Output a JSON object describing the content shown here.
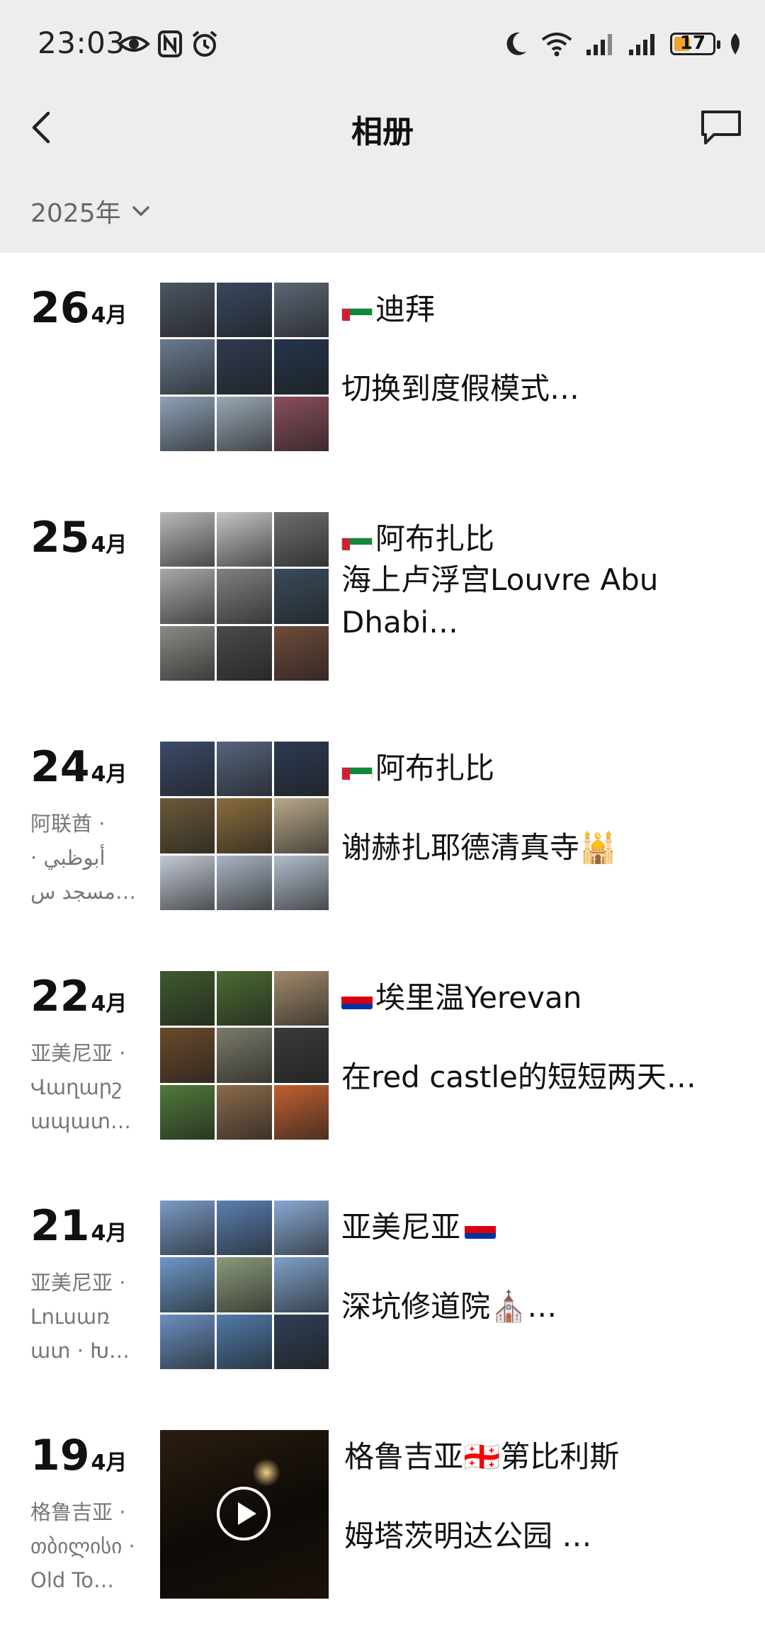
{
  "status_bar": {
    "time": "23:03",
    "battery": "17",
    "icons": [
      "eye-icon",
      "nfc-icon",
      "alarm-icon",
      "moon-icon",
      "wifi-icon",
      "signal-icon",
      "signal-icon",
      "battery-icon",
      "leaf-icon"
    ]
  },
  "header": {
    "title": "相册",
    "back_icon": "chevron-left-icon",
    "message_icon": "message-icon"
  },
  "filter": {
    "year": "2025年"
  },
  "entries": [
    {
      "day": "26",
      "month": "4月",
      "location": "",
      "title": "迪拜",
      "title_flag": "uae",
      "desc": "切换到度假模式…",
      "thumbs": [
        "#4c5562",
        "#39485e",
        "#5b6675",
        "#6a7b8f",
        "#2f3b4f",
        "#24354b",
        "#8fa2b7",
        "#9aa8b5",
        "#8b4e5a"
      ]
    },
    {
      "day": "25",
      "month": "4月",
      "location": "",
      "title": "阿布扎比",
      "title_flag": "uae",
      "desc": "海上卢浮宫Louvre Abu Dhabi…",
      "thumbs": [
        "#b9b9b9",
        "#c4c4c4",
        "#6e6e6e",
        "#a8a8a8",
        "#808080",
        "#3a4b5a",
        "#8c8a84",
        "#4a4a4a",
        "#6f4b3a"
      ]
    },
    {
      "day": "24",
      "month": "4月",
      "location": "阿联酋 · أبوظبي · مسجد س…",
      "title": "阿布扎比",
      "title_flag": "uae",
      "desc": "谢赫扎耶德清真寺🕌",
      "thumbs": [
        "#3c4b6a",
        "#56647c",
        "#2d3a52",
        "#6b5a3a",
        "#8a6d3d",
        "#b7a88a",
        "#c3cad6",
        "#a9b4c2",
        "#b1bdcb"
      ]
    },
    {
      "day": "22",
      "month": "4月",
      "location": "亚美尼亚 · Վաղարշ ապատ…",
      "title": "埃里温Yerevan",
      "title_flag": "armenia",
      "desc": "在red castle的短短两天…",
      "thumbs": [
        "#3f5a2d",
        "#4b6b32",
        "#a08a6a",
        "#6b4a2b",
        "#7b7a6a",
        "#3a3a3a",
        "#507a3a",
        "#8a6a4a",
        "#c06030"
      ]
    },
    {
      "day": "21",
      "month": "4月",
      "location": "亚美尼亚 · Լուսառ ատ · Խ…",
      "title": "亚美尼亚",
      "title_flag": "armenia",
      "desc": "深坑修道院⛪…",
      "thumbs": [
        "#7a9bc6",
        "#5b7fb0",
        "#88a9d3",
        "#6c98c7",
        "#8a9a7a",
        "#7ea0c8",
        "#6a8fbf",
        "#4f7aa8",
        "#2f3f55"
      ]
    },
    {
      "day": "19",
      "month": "4月",
      "location": "格鲁吉亚 · თბილისი · Old To…",
      "title": "格鲁吉亚🇬🇪第比利斯",
      "title_flag": "",
      "desc": "姆塔茨明达公园 …",
      "thumbs": []
    }
  ]
}
